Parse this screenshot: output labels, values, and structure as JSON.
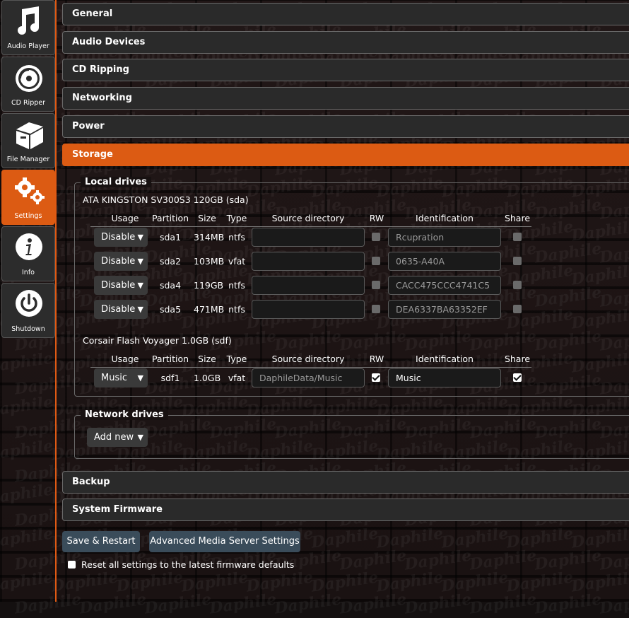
{
  "sidebar": {
    "items": [
      {
        "label": "Audio Player",
        "icon": "music-note-icon"
      },
      {
        "label": "CD Ripper",
        "icon": "cd-icon"
      },
      {
        "label": "File Manager",
        "icon": "box-icon"
      },
      {
        "label": "Settings",
        "icon": "gears-icon"
      },
      {
        "label": "Info",
        "icon": "info-icon"
      },
      {
        "label": "Shutdown",
        "icon": "power-icon"
      }
    ]
  },
  "sections": {
    "general": "General",
    "audio_devices": "Audio Devices",
    "cd_ripping": "CD Ripping",
    "networking": "Networking",
    "power": "Power",
    "storage": "Storage",
    "backup": "Backup",
    "system_firmware": "System Firmware"
  },
  "storage": {
    "local_drives": {
      "legend": "Local drives",
      "columns": {
        "usage": "Usage",
        "partition": "Partition",
        "size": "Size",
        "type": "Type",
        "source": "Source directory",
        "rw": "RW",
        "identification": "Identification",
        "share": "Share"
      },
      "drives": [
        {
          "title": "ATA KINGSTON SV300S3 120GB (sda)",
          "rows": [
            {
              "usage": "Disable",
              "partition": "sda1",
              "size": "314MB",
              "type": "ntfs",
              "source": "",
              "rw": false,
              "identification": "Rcupration",
              "share": false
            },
            {
              "usage": "Disable",
              "partition": "sda2",
              "size": "103MB",
              "type": "vfat",
              "source": "",
              "rw": false,
              "identification": "0635-A40A",
              "share": false
            },
            {
              "usage": "Disable",
              "partition": "sda4",
              "size": "119GB",
              "type": "ntfs",
              "source": "",
              "rw": false,
              "identification": "CACC475CCC4741C5",
              "share": false
            },
            {
              "usage": "Disable",
              "partition": "sda5",
              "size": "471MB",
              "type": "ntfs",
              "source": "",
              "rw": false,
              "identification": "DEA6337BA63352EF",
              "share": false
            }
          ]
        },
        {
          "title": "Corsair Flash Voyager 1.0GB (sdf)",
          "rows": [
            {
              "usage": "Music",
              "partition": "sdf1",
              "size": "1.0GB",
              "type": "vfat",
              "source": "DaphileData/Music",
              "rw": true,
              "identification": "Music",
              "share": true
            }
          ]
        }
      ]
    },
    "network_drives": {
      "legend": "Network drives",
      "add_label": "Add new"
    }
  },
  "actions": {
    "save_restart": "Save & Restart",
    "advanced": "Advanced Media Server Settings",
    "reset_label": "Reset all settings to the latest firmware defaults"
  },
  "colors": {
    "accent": "#dc5b13",
    "button": "#3a4c5a"
  }
}
